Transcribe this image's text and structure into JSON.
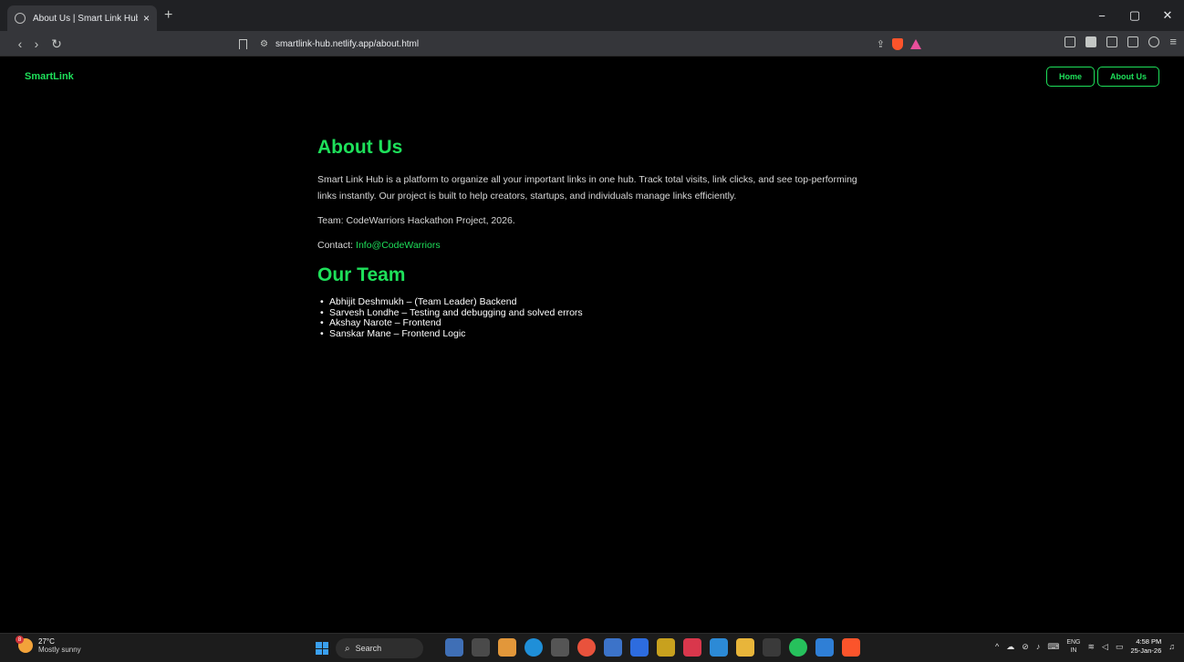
{
  "browser": {
    "tab_title": "About Us | Smart Link Hub",
    "tab_close": "×",
    "new_tab": "+",
    "url": "smartlink-hub.netlify.app/about.html",
    "window_controls": [
      "−",
      "▢",
      "✕"
    ]
  },
  "site": {
    "brand": "SmartLink",
    "nav": [
      "Home",
      "About Us"
    ],
    "heading": "About Us",
    "description": "Smart Link Hub is a platform to organize all your important links in one hub. Track total visits, link clicks, and see top-performing links instantly. Our project is built to help creators, startups, and individuals manage links efficiently.",
    "team_line": "Team: CodeWarriors Hackathon Project, 2026.",
    "contact_label": "Contact: ",
    "contact_link": "Info@CodeWarriors",
    "team_heading": "Our Team",
    "team_members": [
      "Abhijit Deshmukh – (Team Leader) Backend",
      "Sarvesh Londhe – Testing and debugging and solved errors",
      "Akshay Narote – Frontend",
      "Sanskar Mane – Frontend Logic"
    ]
  },
  "taskbar": {
    "weather_badge": "8",
    "temperature": "27°C",
    "weather_desc": "Mostly sunny",
    "search_label": "Search",
    "lang_top": "ENG",
    "lang_bottom": "IN",
    "time": "4:58 PM",
    "date": "25-Jan-26"
  },
  "colors": {
    "accent": "#1ee05a",
    "background": "#000000"
  }
}
